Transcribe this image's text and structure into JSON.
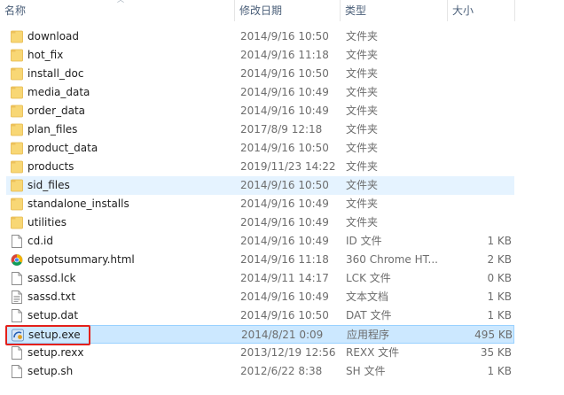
{
  "columns": {
    "name": "名称",
    "date": "修改日期",
    "type": "类型",
    "size": "大小"
  },
  "files": [
    {
      "name": "download",
      "date": "2014/9/16 10:50",
      "type": "文件夹",
      "size": "",
      "icon": "folder-icon"
    },
    {
      "name": "hot_fix",
      "date": "2014/9/16 11:18",
      "type": "文件夹",
      "size": "",
      "icon": "folder-icon"
    },
    {
      "name": "install_doc",
      "date": "2014/9/16 10:50",
      "type": "文件夹",
      "size": "",
      "icon": "folder-icon"
    },
    {
      "name": "media_data",
      "date": "2014/9/16 10:49",
      "type": "文件夹",
      "size": "",
      "icon": "folder-icon"
    },
    {
      "name": "order_data",
      "date": "2014/9/16 10:49",
      "type": "文件夹",
      "size": "",
      "icon": "folder-icon"
    },
    {
      "name": "plan_files",
      "date": "2017/8/9 12:18",
      "type": "文件夹",
      "size": "",
      "icon": "folder-icon"
    },
    {
      "name": "product_data",
      "date": "2014/9/16 10:50",
      "type": "文件夹",
      "size": "",
      "icon": "folder-icon"
    },
    {
      "name": "products",
      "date": "2019/11/23 14:22",
      "type": "文件夹",
      "size": "",
      "icon": "folder-icon"
    },
    {
      "name": "sid_files",
      "date": "2014/9/16 10:50",
      "type": "文件夹",
      "size": "",
      "icon": "folder-icon",
      "state": "hover"
    },
    {
      "name": "standalone_installs",
      "date": "2014/9/16 10:49",
      "type": "文件夹",
      "size": "",
      "icon": "folder-icon"
    },
    {
      "name": "utilities",
      "date": "2014/9/16 10:49",
      "type": "文件夹",
      "size": "",
      "icon": "folder-icon"
    },
    {
      "name": "cd.id",
      "date": "2014/9/16 10:49",
      "type": "ID 文件",
      "size": "1 KB",
      "icon": "file-icon"
    },
    {
      "name": "depotsummary.html",
      "date": "2014/9/16 11:18",
      "type": "360 Chrome HT...",
      "size": "2 KB",
      "icon": "chrome-icon"
    },
    {
      "name": "sassd.lck",
      "date": "2014/9/11 14:17",
      "type": "LCK 文件",
      "size": "0 KB",
      "icon": "file-icon"
    },
    {
      "name": "sassd.txt",
      "date": "2014/9/16 10:49",
      "type": "文本文档",
      "size": "1 KB",
      "icon": "text-file-icon"
    },
    {
      "name": "setup.dat",
      "date": "2014/9/16 10:50",
      "type": "DAT 文件",
      "size": "1 KB",
      "icon": "file-icon"
    },
    {
      "name": "setup.exe",
      "date": "2014/8/21 0:09",
      "type": "应用程序",
      "size": "495 KB",
      "icon": "setup-exe-icon",
      "state": "selected"
    },
    {
      "name": "setup.rexx",
      "date": "2013/12/19 12:56",
      "type": "REXX 文件",
      "size": "35 KB",
      "icon": "file-icon"
    },
    {
      "name": "setup.sh",
      "date": "2012/6/22 8:38",
      "type": "SH 文件",
      "size": "1 KB",
      "icon": "file-icon"
    }
  ],
  "colors": {
    "hover": "#e5f3ff",
    "selected": "#cce8ff",
    "highlight_box": "#e4201a",
    "folder": "#f8d775"
  }
}
